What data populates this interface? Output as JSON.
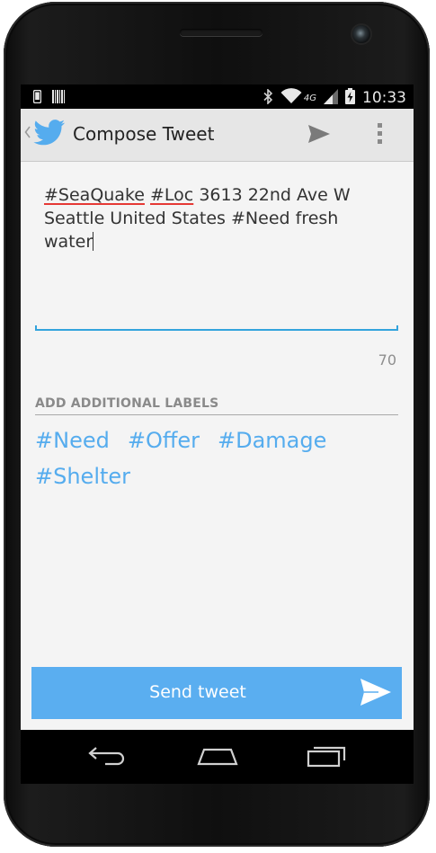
{
  "status_bar": {
    "time": "10:33",
    "network": "4G",
    "icons": [
      "phone-icon",
      "barcode-icon",
      "bluetooth-icon",
      "wifi-icon",
      "signal-icon",
      "battery-charging-icon"
    ]
  },
  "action_bar": {
    "title": "Compose Tweet",
    "icons": [
      "up-caret-icon",
      "twitter-bird-icon",
      "send-icon",
      "overflow-menu-icon"
    ]
  },
  "compose": {
    "hashtag_1": "#SeaQuake",
    "hashtag_2": "#Loc",
    "location_text": "3613 22nd Ave W Seattle United States",
    "need_text": "#Need fresh water",
    "char_counter": "70"
  },
  "labels_section": {
    "header": "ADD ADDITIONAL LABELS",
    "items": [
      "#Need",
      "#Offer",
      "#Damage",
      "#Shelter"
    ]
  },
  "send_button": {
    "label": "Send tweet",
    "icon": "send-icon"
  },
  "colors": {
    "accent_blue": "#55acee",
    "button_blue": "#5aaef0",
    "input_underline": "#33a3dc",
    "spellcheck_red": "#e53935",
    "status_bar": "#000000",
    "action_bar": "#e6e6e6"
  },
  "nav_bar": {
    "icons": [
      "back-icon",
      "home-icon",
      "recent-apps-icon"
    ]
  }
}
